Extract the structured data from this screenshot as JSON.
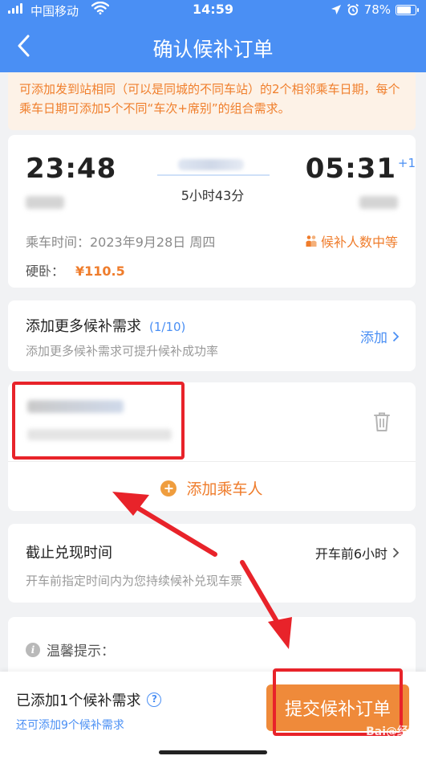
{
  "status_bar": {
    "carrier": "中国移动",
    "time": "14:59",
    "battery": "78%",
    "battery_level": 0.78
  },
  "nav": {
    "title": "确认候补订单"
  },
  "notice": {
    "text": "可添加发到站相同（可以是同城的不同车站）的2个相邻乘车日期，每个乘车日期可添加5个不同“车次+席别”的组合需求。"
  },
  "train": {
    "depart_time": "23:48",
    "arrive_time": "05:31",
    "day_offset": "+1",
    "duration": "5小时43分",
    "ride_date": "乘车时间：2023年9月28日 周四",
    "seat": "硬卧：",
    "price": "¥110.5",
    "queue_status": "候补人数中等"
  },
  "more_demands": {
    "title": "添加更多候补需求",
    "count": "(1/10)",
    "subtitle": "添加更多候补需求可提升候补成功率",
    "add_label": "添加"
  },
  "passenger": {
    "add_label": "添加乘车人"
  },
  "deadline": {
    "title": "截止兑现时间",
    "value": "开车前6小时",
    "subtitle": "开车前指定时间内为您持续候补兑现车票"
  },
  "tips": {
    "title": "温馨提示："
  },
  "bottom": {
    "added_text": "已添加1个候补需求",
    "remaining_text": "还可添加9个候补需求",
    "submit_label": "提交候补订单"
  },
  "colors": {
    "primary": "#4a8ff4",
    "accent": "#ef8a3a",
    "annotation": "#e8232a"
  }
}
